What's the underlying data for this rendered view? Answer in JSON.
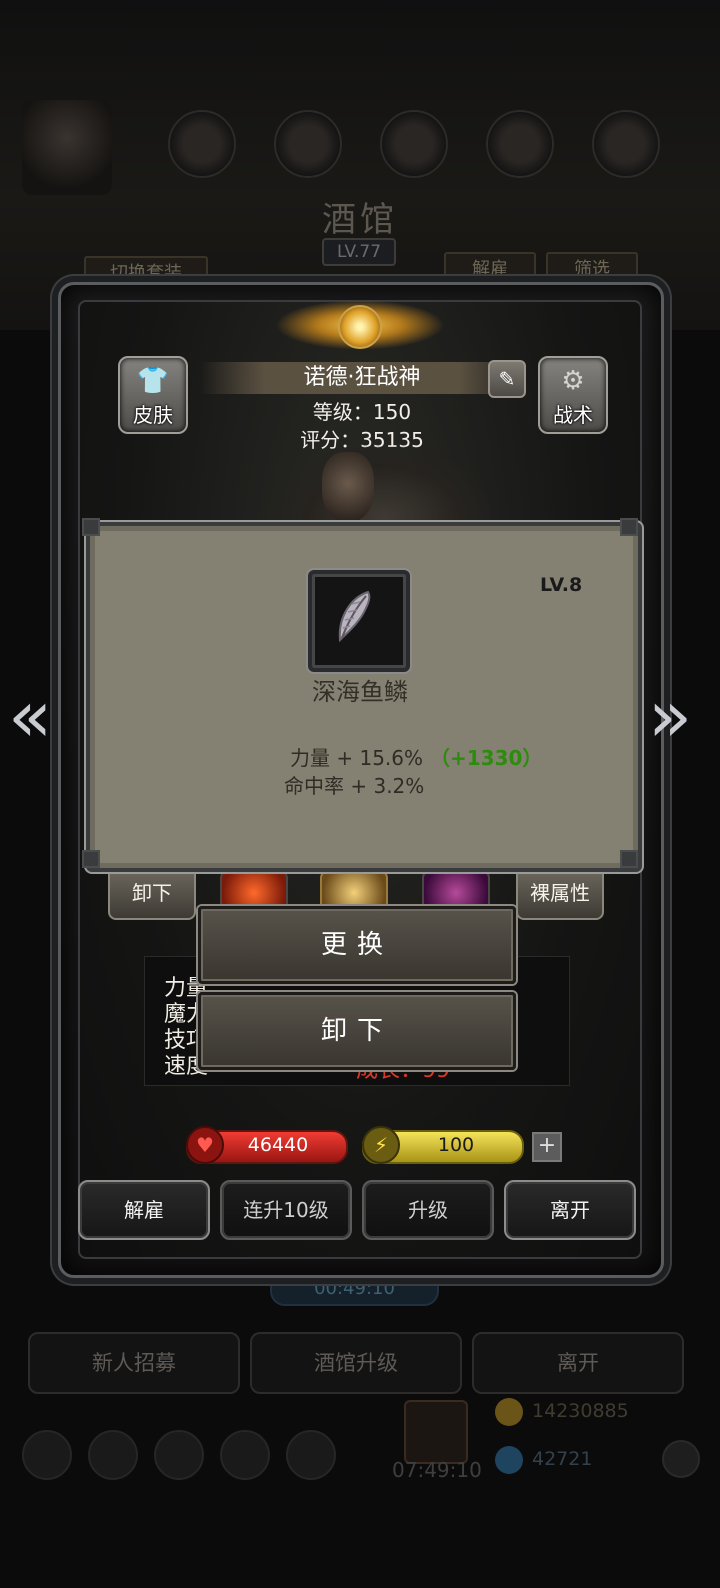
{
  "background": {
    "title": "酒馆",
    "level": "LV.77",
    "switch_outfit": "切换套装",
    "dismiss": "解雇",
    "filter": "筛选",
    "timer": "00:49:10",
    "bottom_buttons": [
      "新人招募",
      "酒馆升级",
      "离开"
    ],
    "timer2": "07:49:10",
    "gold": "14230885",
    "gems": "42721"
  },
  "hero": {
    "name": "诺德·狂战神",
    "level_line": "等级：150",
    "score_line": "评分：35135",
    "skin_label": "皮肤",
    "tactics_label": "战术"
  },
  "tooltip": {
    "level": "LV.8",
    "item_name": "深海鱼鳞",
    "stat1": "力量 + 15.6%",
    "stat1_bonus": "（+1330）",
    "stat2": "命中率 + 3.2%"
  },
  "equipment": {
    "unequip_label": "卸下",
    "bare_stats_label": "裸属性"
  },
  "stats_behind": {
    "labels": [
      "力量",
      "魔力",
      "技巧",
      "速度"
    ],
    "growth_partial": "成长：99"
  },
  "context_menu": {
    "replace": "更换",
    "unequip": "卸下"
  },
  "resources": {
    "hp": "46440",
    "energy": "100",
    "plus": "+"
  },
  "actions": {
    "dismiss": "解雇",
    "level_up_10": "连升10级",
    "level_up": "升级",
    "leave": "离开"
  },
  "colors": {
    "tooltip_bg": "#858172",
    "bonus_green": "#2d8b0d",
    "hp_red": "#e0332b",
    "energy_yellow": "#e8d43a"
  }
}
